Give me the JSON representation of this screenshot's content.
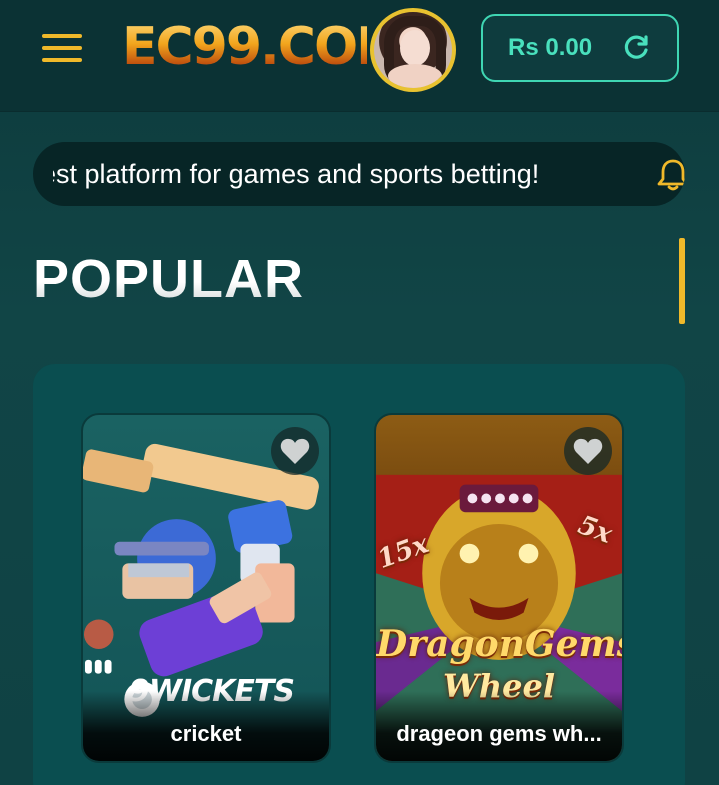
{
  "header": {
    "logo_text": "EC99.COM",
    "balance": "Rs 0.00",
    "icons": {
      "menu": "hamburger-menu-icon",
      "refresh": "refresh-icon"
    }
  },
  "notice": {
    "text": "est platform for games and sports betting!",
    "icon": "bell-icon"
  },
  "section": {
    "title": "POPULAR"
  },
  "games": [
    {
      "name": "cricket",
      "brand": "9WICKETS"
    },
    {
      "name": "drageon gems wh...",
      "logo_line1": "DragonGems",
      "logo_line2": "Wheel",
      "multiplier_left": "15x",
      "multiplier_right": "5x"
    }
  ],
  "colors": {
    "accent_gold": "#f0b92a",
    "accent_teal": "#49e0bd",
    "background": "#114546",
    "panel": "#0a4e50"
  }
}
